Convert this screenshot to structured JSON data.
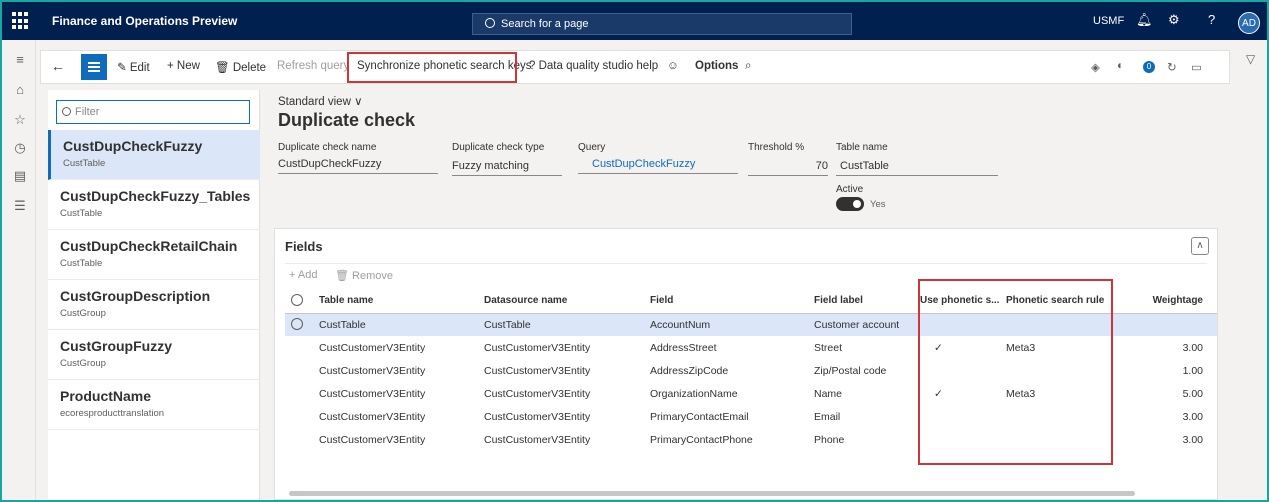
{
  "topbar": {
    "app_title": "Finance and Operations Preview",
    "search_placeholder": "Search for a page",
    "company": "USMF",
    "avatar_initials": "AD"
  },
  "actionbar": {
    "edit": "Edit",
    "new": "New",
    "delete": "Delete",
    "refresh_query": "Refresh query",
    "sync_phonetic": "Synchronize phonetic search keys",
    "help": "Data quality studio help",
    "options": "Options",
    "badge_count": "0"
  },
  "list": {
    "filter_placeholder": "Filter",
    "items": [
      {
        "title": "CustDupCheckFuzzy",
        "sub": "CustTable"
      },
      {
        "title": "CustDupCheckFuzzy_Tables",
        "sub": "CustTable"
      },
      {
        "title": "CustDupCheckRetailChain",
        "sub": "CustTable"
      },
      {
        "title": "CustGroupDescription",
        "sub": "CustGroup"
      },
      {
        "title": "CustGroupFuzzy",
        "sub": "CustGroup"
      },
      {
        "title": "ProductName",
        "sub": "ecoresproducttranslation"
      }
    ]
  },
  "header": {
    "view": "Standard view",
    "title": "Duplicate check",
    "fields": {
      "name_label": "Duplicate check name",
      "name_value": "CustDupCheckFuzzy",
      "type_label": "Duplicate check type",
      "type_value": "Fuzzy matching",
      "query_label": "Query",
      "query_value": "CustDupCheckFuzzy",
      "threshold_label": "Threshold %",
      "threshold_value": "70",
      "table_label": "Table name",
      "table_value": "CustTable",
      "active_label": "Active",
      "active_value": "Yes"
    }
  },
  "fields_card": {
    "title": "Fields",
    "add": "Add",
    "remove": "Remove",
    "columns": [
      "Table name",
      "Datasource name",
      "Field",
      "Field label",
      "Use phonetic s...",
      "Phonetic search rule",
      "Weightage"
    ],
    "rows": [
      {
        "table": "CustTable",
        "datasource": "CustTable",
        "field": "AccountNum",
        "label": "Customer account",
        "phonetic": "",
        "rule": "",
        "weight": ""
      },
      {
        "table": "CustCustomerV3Entity",
        "datasource": "CustCustomerV3Entity",
        "field": "AddressStreet",
        "label": "Street",
        "phonetic": "✓",
        "rule": "Meta3",
        "weight": "3.00"
      },
      {
        "table": "CustCustomerV3Entity",
        "datasource": "CustCustomerV3Entity",
        "field": "AddressZipCode",
        "label": "Zip/Postal code",
        "phonetic": "",
        "rule": "",
        "weight": "1.00"
      },
      {
        "table": "CustCustomerV3Entity",
        "datasource": "CustCustomerV3Entity",
        "field": "OrganizationName",
        "label": "Name",
        "phonetic": "✓",
        "rule": "Meta3",
        "weight": "5.00"
      },
      {
        "table": "CustCustomerV3Entity",
        "datasource": "CustCustomerV3Entity",
        "field": "PrimaryContactEmail",
        "label": "Email",
        "phonetic": "",
        "rule": "",
        "weight": "3.00"
      },
      {
        "table": "CustCustomerV3Entity",
        "datasource": "CustCustomerV3Entity",
        "field": "PrimaryContactPhone",
        "label": "Phone",
        "phonetic": "",
        "rule": "",
        "weight": "3.00"
      }
    ]
  },
  "colors": {
    "topbar": "#002050",
    "accent": "#0f6cbd",
    "selected_row": "#dbe6f9",
    "highlight_box": "#d13438"
  }
}
